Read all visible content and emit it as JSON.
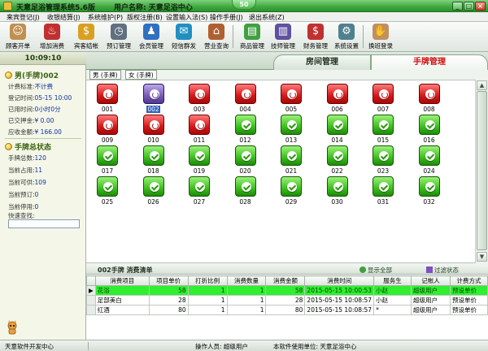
{
  "titlebar": {
    "app_title": "天意足浴管理系统5.6版",
    "user_label": "用户名称: 天意足浴中心",
    "badge": "50",
    "minimize": "_",
    "maximize": "□",
    "close": "×"
  },
  "menubar": [
    "来宾登记(J)",
    "收银结算(J)",
    "系统维护(P)",
    "版权注册(B)",
    "设置输入法(S)",
    "操作手册(J)",
    "退出系统(Z)"
  ],
  "toolbar": [
    {
      "label": "顾客开单",
      "icon": "customer-icon",
      "glyph": "☺",
      "color": "#c09050"
    },
    {
      "label": "增加消费",
      "icon": "wine-icon",
      "glyph": "♨",
      "color": "#c03030"
    },
    {
      "label": "宾客结帐",
      "icon": "coins-icon",
      "glyph": "$",
      "color": "#d8a020"
    },
    {
      "label": "预订管理",
      "icon": "clock-icon",
      "glyph": "◷",
      "color": "#607080"
    },
    {
      "label": "会员管理",
      "icon": "members-icon",
      "glyph": "♟",
      "color": "#3070c0"
    },
    {
      "label": "短信群发",
      "icon": "sms-icon",
      "glyph": "✉",
      "color": "#2090c0"
    },
    {
      "label": "营业查询",
      "icon": "query-icon",
      "glyph": "⌂",
      "color": "#b06030"
    },
    {
      "label": "商品管理",
      "icon": "goods-icon",
      "glyph": "▤",
      "color": "#40a040"
    },
    {
      "label": "技师管理",
      "icon": "technician-icon",
      "glyph": "▥",
      "color": "#6050a0"
    },
    {
      "label": "财务管理",
      "icon": "finance-icon",
      "glyph": "$",
      "color": "#c03030"
    },
    {
      "label": "系统设置",
      "icon": "settings-icon",
      "glyph": "⚙",
      "color": "#508090"
    },
    {
      "label": "换班登录",
      "icon": "handshake-icon",
      "glyph": "✋",
      "color": "#c09060"
    }
  ],
  "left": {
    "clock": "10:09:10",
    "section1_title": "男(手牌)002",
    "info": [
      {
        "label": "计费标准:",
        "value": "不计费"
      },
      {
        "label": "登记时间:",
        "value": "05-15 10:00"
      },
      {
        "label": "已用时间:",
        "value": "0小时0分"
      },
      {
        "label": "已交押金:",
        "value": "¥ 0.00"
      },
      {
        "label": "应收金额:",
        "value": "¥ 166.00"
      }
    ],
    "section2_title": "手牌总状态",
    "stats": [
      {
        "label": "手牌总数:",
        "value": "120"
      },
      {
        "label": "当前占用:",
        "value": "11"
      },
      {
        "label": "当前可供:",
        "value": "109"
      },
      {
        "label": "当前预订:",
        "value": "0"
      },
      {
        "label": "当前停用:",
        "value": "0"
      }
    ],
    "quick_search_label": "快速查找:"
  },
  "tabs": {
    "room": "房间管理",
    "hand": "手牌管理"
  },
  "subtabs": [
    "男 (手牌)",
    "女 (手牌)"
  ],
  "cards": [
    {
      "code": "001",
      "state": "occupied"
    },
    {
      "code": "002",
      "state": "selected"
    },
    {
      "code": "003",
      "state": "occupied"
    },
    {
      "code": "004",
      "state": "occupied"
    },
    {
      "code": "005",
      "state": "occupied"
    },
    {
      "code": "006",
      "state": "occupied"
    },
    {
      "code": "007",
      "state": "occupied"
    },
    {
      "code": "008",
      "state": "occupied"
    },
    {
      "code": "009",
      "state": "occupied"
    },
    {
      "code": "010",
      "state": "occupied"
    },
    {
      "code": "011",
      "state": "occupied"
    },
    {
      "code": "012",
      "state": "free"
    },
    {
      "code": "013",
      "state": "free"
    },
    {
      "code": "014",
      "state": "free"
    },
    {
      "code": "015",
      "state": "free"
    },
    {
      "code": "016",
      "state": "free"
    },
    {
      "code": "017",
      "state": "free"
    },
    {
      "code": "018",
      "state": "free"
    },
    {
      "code": "019",
      "state": "free"
    },
    {
      "code": "020",
      "state": "free"
    },
    {
      "code": "021",
      "state": "free"
    },
    {
      "code": "022",
      "state": "free"
    },
    {
      "code": "023",
      "state": "free"
    },
    {
      "code": "024",
      "state": "free"
    },
    {
      "code": "025",
      "state": "free"
    },
    {
      "code": "026",
      "state": "free"
    },
    {
      "code": "027",
      "state": "free"
    },
    {
      "code": "028",
      "state": "free"
    },
    {
      "code": "029",
      "state": "free"
    },
    {
      "code": "030",
      "state": "free"
    },
    {
      "code": "031",
      "state": "free"
    },
    {
      "code": "032",
      "state": "free"
    }
  ],
  "consumption": {
    "title": "002手牌   消费清单",
    "show_all": "显示全部",
    "filter": "过滤状态",
    "columns": [
      "消费项目",
      "项目单价",
      "打折比例",
      "消费数量",
      "消费金额",
      "消费时间",
      "服务生",
      "记帐人",
      "计费方式"
    ],
    "rows": [
      {
        "marker": "▶",
        "item": "花浴",
        "price": "58",
        "discount": "1",
        "qty": "1",
        "amount": "58",
        "time": "2015-05-15 10:00:53",
        "waiter": "小赵",
        "recorder": "超级用户",
        "billing": "预设单价"
      },
      {
        "marker": "",
        "item": "足部美白",
        "price": "28",
        "discount": "1",
        "qty": "1",
        "amount": "28",
        "time": "2015-05-15 10:08:57",
        "waiter": "小赵",
        "recorder": "超级用户",
        "billing": "预设单价"
      },
      {
        "marker": "",
        "item": "红酒",
        "price": "80",
        "discount": "1",
        "qty": "1",
        "amount": "80",
        "time": "2015-05-15 10:08:57",
        "waiter": "*",
        "recorder": "超级用户",
        "billing": "预设单价"
      }
    ]
  },
  "statusbar": {
    "left": "天意软件开发中心",
    "operator": "操作人员: 超级用户",
    "unit": "本软件使用单位: 天意足浴中心"
  },
  "colors": {
    "occupied": "#d41818",
    "free": "#3cc01c",
    "selected": "#7a5ab8",
    "highlight_row": "#30ee30"
  }
}
